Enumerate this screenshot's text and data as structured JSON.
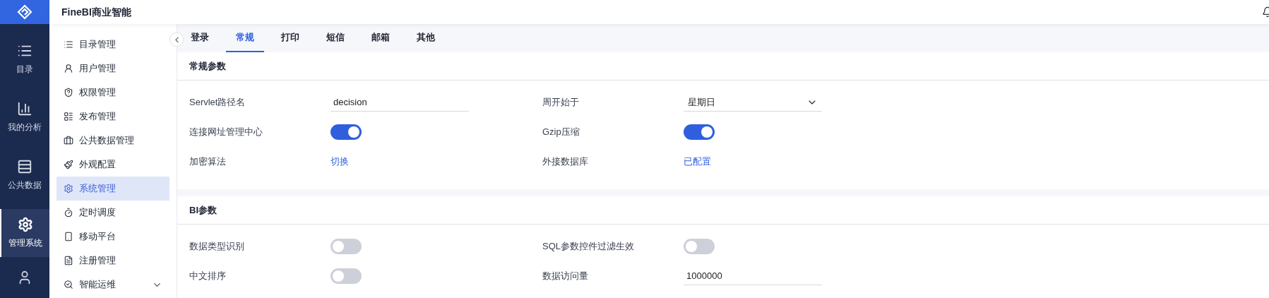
{
  "app": {
    "title": "FineBI商业智能"
  },
  "nav": [
    {
      "label": "目录",
      "selected": false
    },
    {
      "label": "我的分析",
      "selected": false
    },
    {
      "label": "公共数据",
      "selected": false
    },
    {
      "label": "管理系统",
      "selected": true
    }
  ],
  "sidebar": {
    "items": [
      {
        "label": "目录管理",
        "selected": false
      },
      {
        "label": "用户管理",
        "selected": false
      },
      {
        "label": "权限管理",
        "selected": false
      },
      {
        "label": "发布管理",
        "selected": false
      },
      {
        "label": "公共数据管理",
        "selected": false
      },
      {
        "label": "外观配置",
        "selected": false
      },
      {
        "label": "系统管理",
        "selected": true
      },
      {
        "label": "定时调度",
        "selected": false
      },
      {
        "label": "移动平台",
        "selected": false
      },
      {
        "label": "注册管理",
        "selected": false
      },
      {
        "label": "智能运维",
        "selected": false,
        "expanded": false
      }
    ]
  },
  "tabs": [
    {
      "label": "登录",
      "selected": false
    },
    {
      "label": "常规",
      "selected": true
    },
    {
      "label": "打印",
      "selected": false
    },
    {
      "label": "短信",
      "selected": false
    },
    {
      "label": "邮箱",
      "selected": false
    },
    {
      "label": "其他",
      "selected": false
    }
  ],
  "sections": [
    {
      "title": "常规参数",
      "fields": [
        {
          "label": "Servlet路径名",
          "kind": "text",
          "value": "decision"
        },
        {
          "label": "周开始于",
          "kind": "select",
          "value": "星期日"
        },
        {
          "label": "连接网址管理中心",
          "kind": "toggle",
          "on": true
        },
        {
          "label": "Gzip压缩",
          "kind": "toggle",
          "on": true
        },
        {
          "label": "加密算法",
          "kind": "link",
          "value": "切换"
        },
        {
          "label": "外接数据库",
          "kind": "link",
          "value": "已配置"
        }
      ]
    },
    {
      "title": "BI参数",
      "fields": [
        {
          "label": "数据类型识别",
          "kind": "toggle",
          "on": false
        },
        {
          "label": "SQL参数控件过滤生效",
          "kind": "toggle",
          "on": false
        },
        {
          "label": "中文排序",
          "kind": "toggle",
          "on": false
        },
        {
          "label": "数据访问量",
          "kind": "text",
          "value": "1000000"
        }
      ]
    }
  ]
}
